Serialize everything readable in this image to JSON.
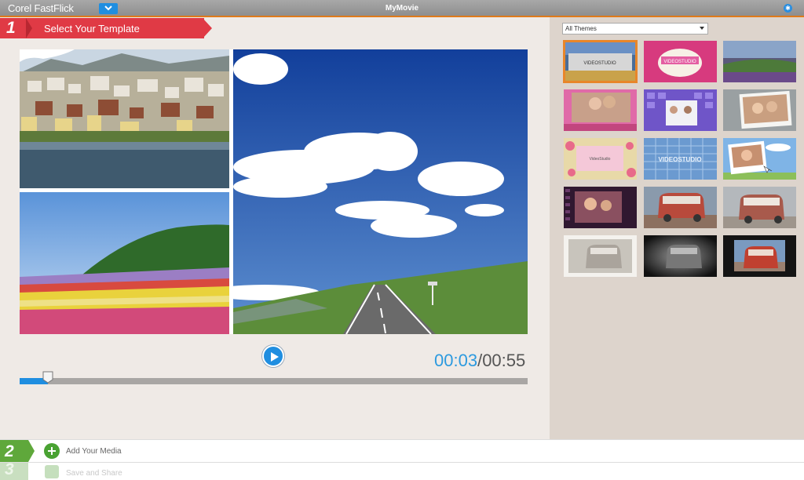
{
  "app": {
    "title": "Corel FastFlick",
    "project_name": "MyMovie",
    "menu_icon": "chevron-down-icon",
    "help_icon": "globe-help-icon",
    "accent_color": "#e07a1a"
  },
  "step1": {
    "number": "1",
    "label": "Select Your Template",
    "color": "#e03a45"
  },
  "preview": {
    "panels": [
      "town-lake-photo",
      "flower-field-photo",
      "road-sky-photo"
    ]
  },
  "playback": {
    "current_time": "00:03",
    "separator": "/",
    "total_time": "00:55",
    "progress_fraction": 0.055,
    "play_icon": "play-icon"
  },
  "themes": {
    "filter_value": "All Themes",
    "selected_index": 0,
    "thumbnails": [
      {
        "name": "videostudio-classic",
        "caption": "VIDEOSTUDIO"
      },
      {
        "name": "videostudio-pink-banner",
        "caption": "VIDEOSTUDIO"
      },
      {
        "name": "purple-landscape",
        "caption": ""
      },
      {
        "name": "romance-couple-pink",
        "caption": ""
      },
      {
        "name": "purple-grid-people",
        "caption": ""
      },
      {
        "name": "couple-polaroid",
        "caption": ""
      },
      {
        "name": "floral-frame",
        "caption": "VideoStudio"
      },
      {
        "name": "videostudio-blue-tiles",
        "caption": "VIDEOSTUDIO"
      },
      {
        "name": "sky-polaroid",
        "caption": ""
      },
      {
        "name": "filmstrip-family",
        "caption": ""
      },
      {
        "name": "van-sunset",
        "caption": ""
      },
      {
        "name": "van-grey",
        "caption": ""
      },
      {
        "name": "van-framed-light",
        "caption": ""
      },
      {
        "name": "van-spotlight-dark",
        "caption": ""
      },
      {
        "name": "van-red-dark",
        "caption": ""
      }
    ]
  },
  "step2": {
    "number": "2",
    "label": "Add Your Media",
    "icon": "add-media-icon"
  },
  "step3": {
    "number": "3",
    "label": "Save and Share",
    "icon": "save-share-icon"
  }
}
